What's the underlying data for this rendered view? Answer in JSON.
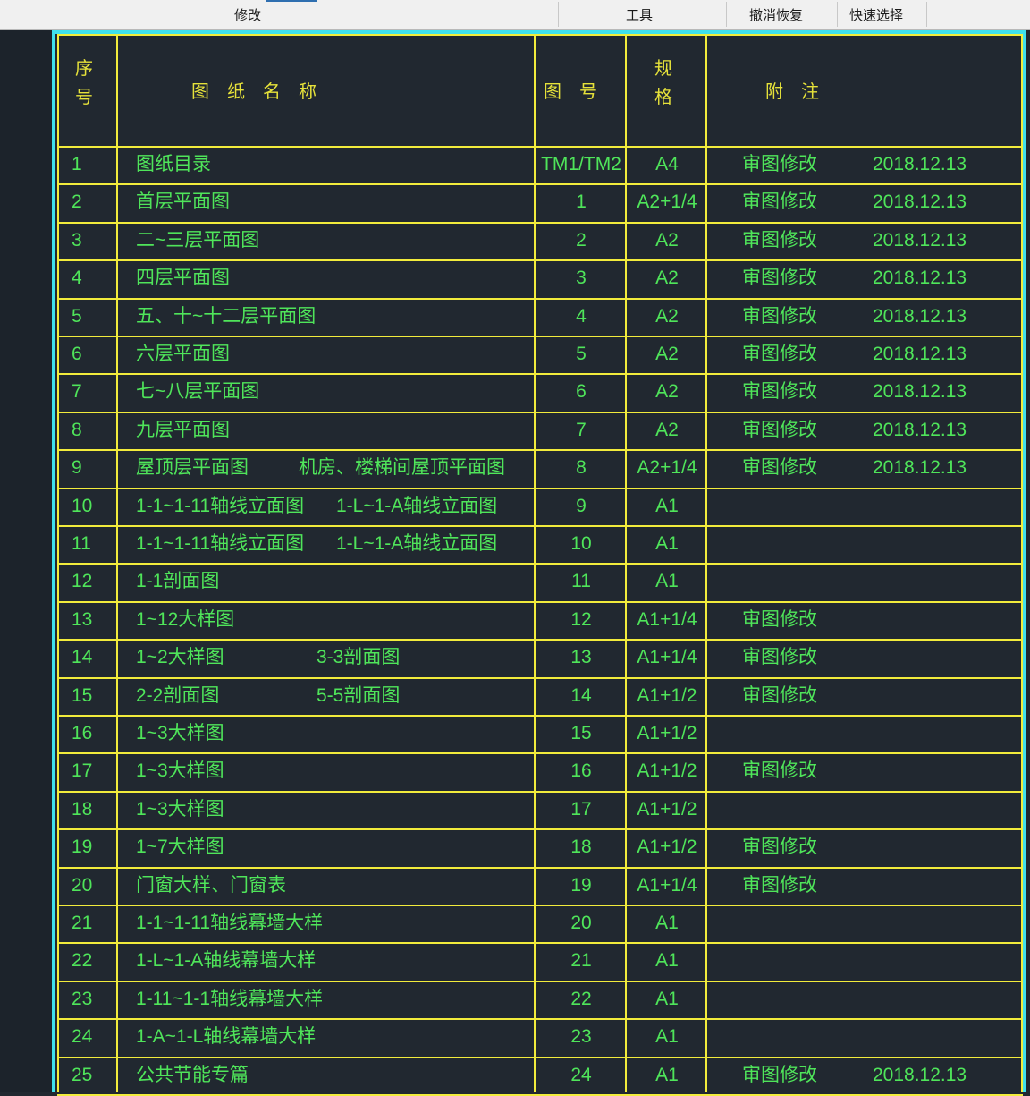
{
  "ribbon": {
    "panels": [
      {
        "label": "修改"
      },
      {
        "label": "工具"
      },
      {
        "label": "撤消恢复"
      },
      {
        "label": "快速选择"
      }
    ]
  },
  "table": {
    "headers": {
      "seq": [
        "序",
        "号"
      ],
      "name": "图　纸　名　称",
      "number": "图　号",
      "spec": [
        "规",
        "格"
      ],
      "note": "附　注"
    },
    "rows": [
      {
        "seq": "1",
        "name": "图纸目录",
        "name2": "",
        "number": "TM1/TM2",
        "spec": "A4",
        "note": "审图修改",
        "date": "2018.12.13"
      },
      {
        "seq": "2",
        "name": "首层平面图",
        "name2": "",
        "number": "1",
        "spec": "A2+1/4",
        "note": "审图修改",
        "date": "2018.12.13"
      },
      {
        "seq": "3",
        "name": "二~三层平面图",
        "name2": "",
        "number": "2",
        "spec": "A2",
        "note": "审图修改",
        "date": "2018.12.13"
      },
      {
        "seq": "4",
        "name": "四层平面图",
        "name2": "",
        "number": "3",
        "spec": "A2",
        "note": "审图修改",
        "date": "2018.12.13"
      },
      {
        "seq": "5",
        "name": "五、十~十二层平面图",
        "name2": "",
        "number": "4",
        "spec": "A2",
        "note": "审图修改",
        "date": "2018.12.13"
      },
      {
        "seq": "6",
        "name": "六层平面图",
        "name2": "",
        "number": "5",
        "spec": "A2",
        "note": "审图修改",
        "date": "2018.12.13"
      },
      {
        "seq": "7",
        "name": "七~八层平面图",
        "name2": "",
        "number": "6",
        "spec": "A2",
        "note": "审图修改",
        "date": "2018.12.13"
      },
      {
        "seq": "8",
        "name": "九层平面图",
        "name2": "",
        "number": "7",
        "spec": "A2",
        "note": "审图修改",
        "date": "2018.12.13"
      },
      {
        "seq": "9",
        "name": "屋顶层平面图",
        "name2": "机房、楼梯间屋顶平面图",
        "number": "8",
        "spec": "A2+1/4",
        "note": "审图修改",
        "date": "2018.12.13"
      },
      {
        "seq": "10",
        "name": "1-1~1-11轴线立面图",
        "name2": "1-L~1-A轴线立面图",
        "number": "9",
        "spec": "A1",
        "note": "",
        "date": ""
      },
      {
        "seq": "11",
        "name": "1-1~1-11轴线立面图",
        "name2": "1-L~1-A轴线立面图",
        "number": "10",
        "spec": "A1",
        "note": "",
        "date": ""
      },
      {
        "seq": "12",
        "name": "1-1剖面图",
        "name2": "",
        "number": "11",
        "spec": "A1",
        "note": "",
        "date": ""
      },
      {
        "seq": "13",
        "name": "1~12大样图",
        "name2": "",
        "number": "12",
        "spec": "A1+1/4",
        "note": "审图修改",
        "date": ""
      },
      {
        "seq": "14",
        "name": "1~2大样图",
        "name2": "3-3剖面图",
        "number": "13",
        "spec": "A1+1/4",
        "note": "审图修改",
        "date": ""
      },
      {
        "seq": "15",
        "name": "2-2剖面图",
        "name2": "5-5剖面图",
        "number": "14",
        "spec": "A1+1/2",
        "note": "审图修改",
        "date": ""
      },
      {
        "seq": "16",
        "name": "1~3大样图",
        "name2": "",
        "number": "15",
        "spec": "A1+1/2",
        "note": "",
        "date": ""
      },
      {
        "seq": "17",
        "name": "1~3大样图",
        "name2": "",
        "number": "16",
        "spec": "A1+1/2",
        "note": "审图修改",
        "date": ""
      },
      {
        "seq": "18",
        "name": "1~3大样图",
        "name2": "",
        "number": "17",
        "spec": "A1+1/2",
        "note": "",
        "date": ""
      },
      {
        "seq": "19",
        "name": "1~7大样图",
        "name2": "",
        "number": "18",
        "spec": "A1+1/2",
        "note": "审图修改",
        "date": ""
      },
      {
        "seq": "20",
        "name": "门窗大样、门窗表",
        "name2": "",
        "number": "19",
        "spec": "A1+1/4",
        "note": "审图修改",
        "date": ""
      },
      {
        "seq": "21",
        "name": "1-1~1-11轴线幕墙大样",
        "name2": "",
        "number": "20",
        "spec": "A1",
        "note": "",
        "date": ""
      },
      {
        "seq": "22",
        "name": "1-L~1-A轴线幕墙大样",
        "name2": "",
        "number": "21",
        "spec": "A1",
        "note": "",
        "date": ""
      },
      {
        "seq": "23",
        "name": "1-11~1-1轴线幕墙大样",
        "name2": "",
        "number": "22",
        "spec": "A1",
        "note": "",
        "date": ""
      },
      {
        "seq": "24",
        "name": "1-A~1-L轴线幕墙大样",
        "name2": "",
        "number": "23",
        "spec": "A1",
        "note": "",
        "date": ""
      },
      {
        "seq": "25",
        "name": "公共节能专篇",
        "name2": "",
        "number": "24",
        "spec": "A1",
        "note": "审图修改",
        "date": "2018.12.13"
      }
    ]
  },
  "colors": {
    "background": "#212830",
    "grid": "#f2ec3c",
    "header_text": "#e6e23a",
    "cell_text": "#4fe55a",
    "selection_frame": "#3fe0ec"
  }
}
